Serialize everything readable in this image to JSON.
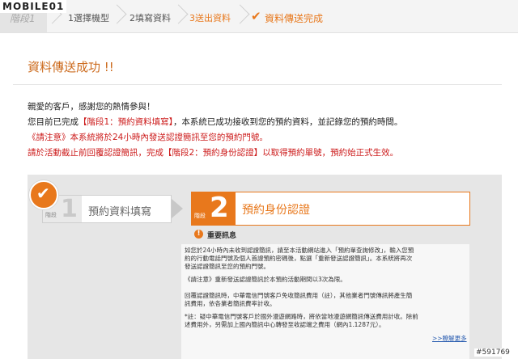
{
  "logo": {
    "text": "MOBILE01"
  },
  "steps": {
    "stage": "階段1",
    "s1": "1選擇機型",
    "s2": "2填寫資料",
    "s3": "3送出資料",
    "s4": "資料傳送完成"
  },
  "page": {
    "title": "資料傳送成功 !!"
  },
  "message": {
    "line1": "親愛的客戶，感謝您的熱情參與！",
    "line2_prefix": "您目前已完成",
    "line2_highlight": "【階段1：預約資料填寫】",
    "line2_suffix": "，本系統已成功接收到您的預約資料，並記錄您的預約時間。",
    "line3": "《請注意》本系統將於24小時內發送認證簡訊至您的預約門號。",
    "line4_prefix": "請於活動截止前回覆認證簡訊，完成",
    "line4_highlight": "【階段2：預約身份認證】",
    "line4_suffix": "以取得預約單號，預約始正式生效。"
  },
  "stage_cards": {
    "stage1": {
      "label": "階段",
      "num": "1",
      "title": "預約資料填寫"
    },
    "stage2": {
      "label": "階段",
      "num": "2",
      "title": "預約身份認證"
    }
  },
  "notice": {
    "title": "重要訊息",
    "p1_l1": "如您於24小時內未收到認證簡訊，請至本活動網站進入「預約單查詢修改」，輸入您預",
    "p1_l2": "約的行動電話門號及個人首證預約密碼後，點選「重新發送認證簡訊」。本系統將再次",
    "p1_l3": "發送認證簡訊至您的預約門號。",
    "p1_l4": "《請注意》重新發送認證簡訊於本預約活動期間以3次為限。",
    "p2_l1": "回覆認證簡訊時，中華電信門號客戶免收簡訊費用（註），其他業者門號傳訊將產生簡",
    "p2_l2": "訊費用，依各業者簡訊費率計收。",
    "p3_l1": "*註：疑中華電信門號客戶於國外漫遊網路時，將依當地漫遊網簡訊傳送費用計收。除前",
    "p3_l2": "述費用外，另需加上國內簡訊中心轉發至收認端之費用（網內1.1287元）。",
    "more_link": ">>瞭解更多"
  },
  "watermark": "#591769",
  "colors": {
    "accent": "#e8781c",
    "red": "#cc1a1a",
    "title": "#cc6b1e",
    "highlight_red": "#cc1a1a"
  }
}
